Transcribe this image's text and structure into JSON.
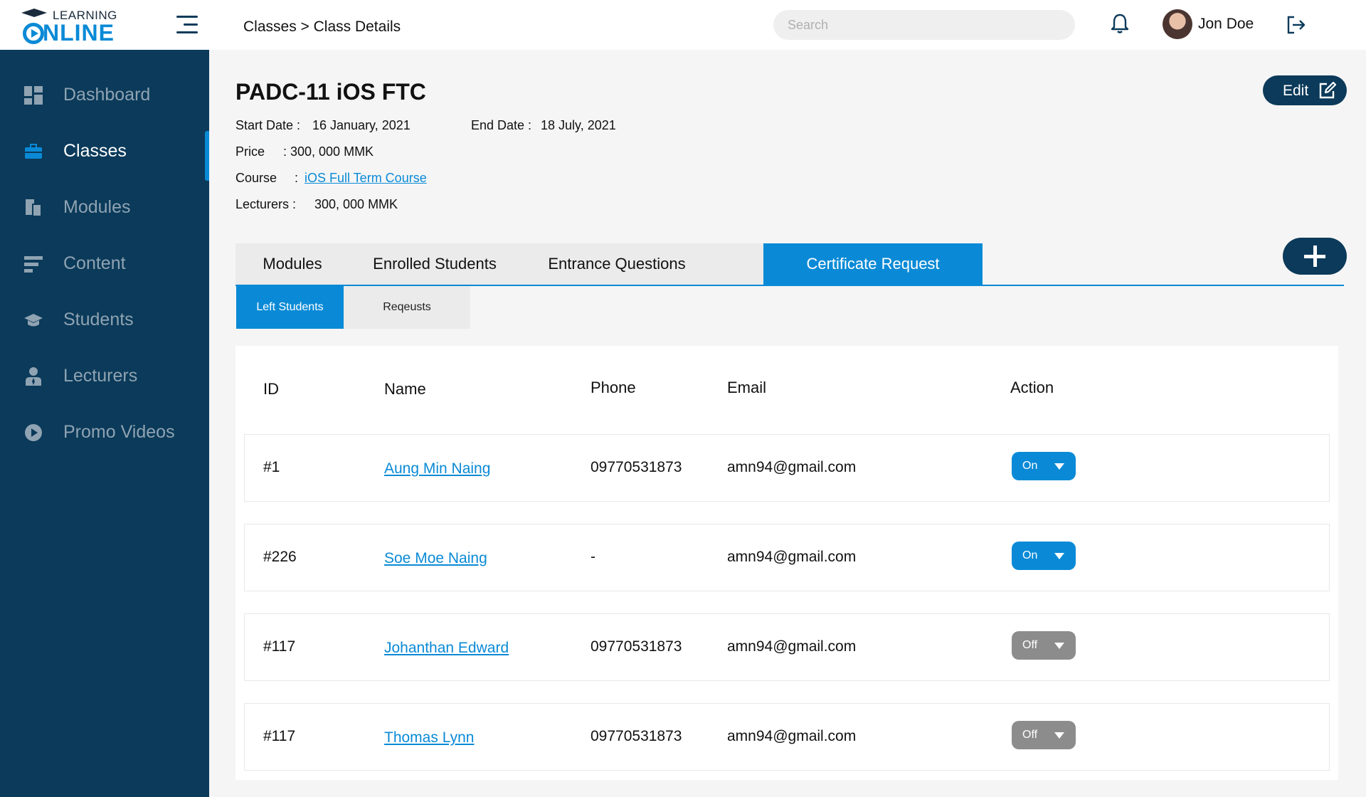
{
  "app": {
    "logo_small": "LEARNING",
    "logo_big": "NLINE"
  },
  "header": {
    "breadcrumb": "Classes > Class Details",
    "search_placeholder": "Search",
    "user_name": "Jon Doe"
  },
  "sidebar": {
    "items": [
      {
        "label": "Dashboard",
        "icon": "dashboard-icon"
      },
      {
        "label": "Classes",
        "icon": "briefcase-icon",
        "active": true
      },
      {
        "label": "Modules",
        "icon": "modules-icon"
      },
      {
        "label": "Content",
        "icon": "content-icon"
      },
      {
        "label": "Students",
        "icon": "graduation-cap-icon"
      },
      {
        "label": "Lecturers",
        "icon": "lecturer-icon"
      },
      {
        "label": "Promo Videos",
        "icon": "play-icon"
      }
    ]
  },
  "class": {
    "title": "PADC-11 iOS FTC",
    "edit_label": "Edit",
    "start_date_label": "Start Date :",
    "start_date": "16 January, 2021",
    "end_date_label": "End Date :",
    "end_date": "18 July, 2021",
    "price_label": "Price",
    "price_value": ": 300, 000 MMK",
    "course_label": "Course",
    "course_colon": ":",
    "course_value": "iOS Full Term Course",
    "lecturers_label": "Lecturers :",
    "lecturers_value": "300, 000 MMK"
  },
  "tabs": [
    {
      "label": "Modules"
    },
    {
      "label": "Enrolled Students"
    },
    {
      "label": "Entrance Questions"
    },
    {
      "label": "Certificate Request",
      "active": true
    }
  ],
  "subtabs": [
    {
      "label": "Left Students",
      "active": true
    },
    {
      "label": "Reqeusts"
    }
  ],
  "table": {
    "headers": {
      "id": "ID",
      "name": "Name",
      "phone": "Phone",
      "email": "Email",
      "action": "Action"
    },
    "rows": [
      {
        "id": "#1",
        "name": "Aung Min Naing",
        "phone": "09770531873",
        "email": "amn94@gmail.com",
        "action": "On"
      },
      {
        "id": "#226",
        "name": "Soe Moe Naing",
        "phone": "-",
        "email": "amn94@gmail.com",
        "action": "On"
      },
      {
        "id": "#117",
        "name": "Johanthan Edward",
        "phone": "09770531873",
        "email": "amn94@gmail.com",
        "action": "Off"
      },
      {
        "id": "#117",
        "name": "Thomas Lynn",
        "phone": "09770531873",
        "email": "amn94@gmail.com",
        "action": "Off"
      }
    ]
  },
  "colors": {
    "primary": "#0a8ad6",
    "navy": "#0b3a5a",
    "off": "#8c8c8c"
  }
}
